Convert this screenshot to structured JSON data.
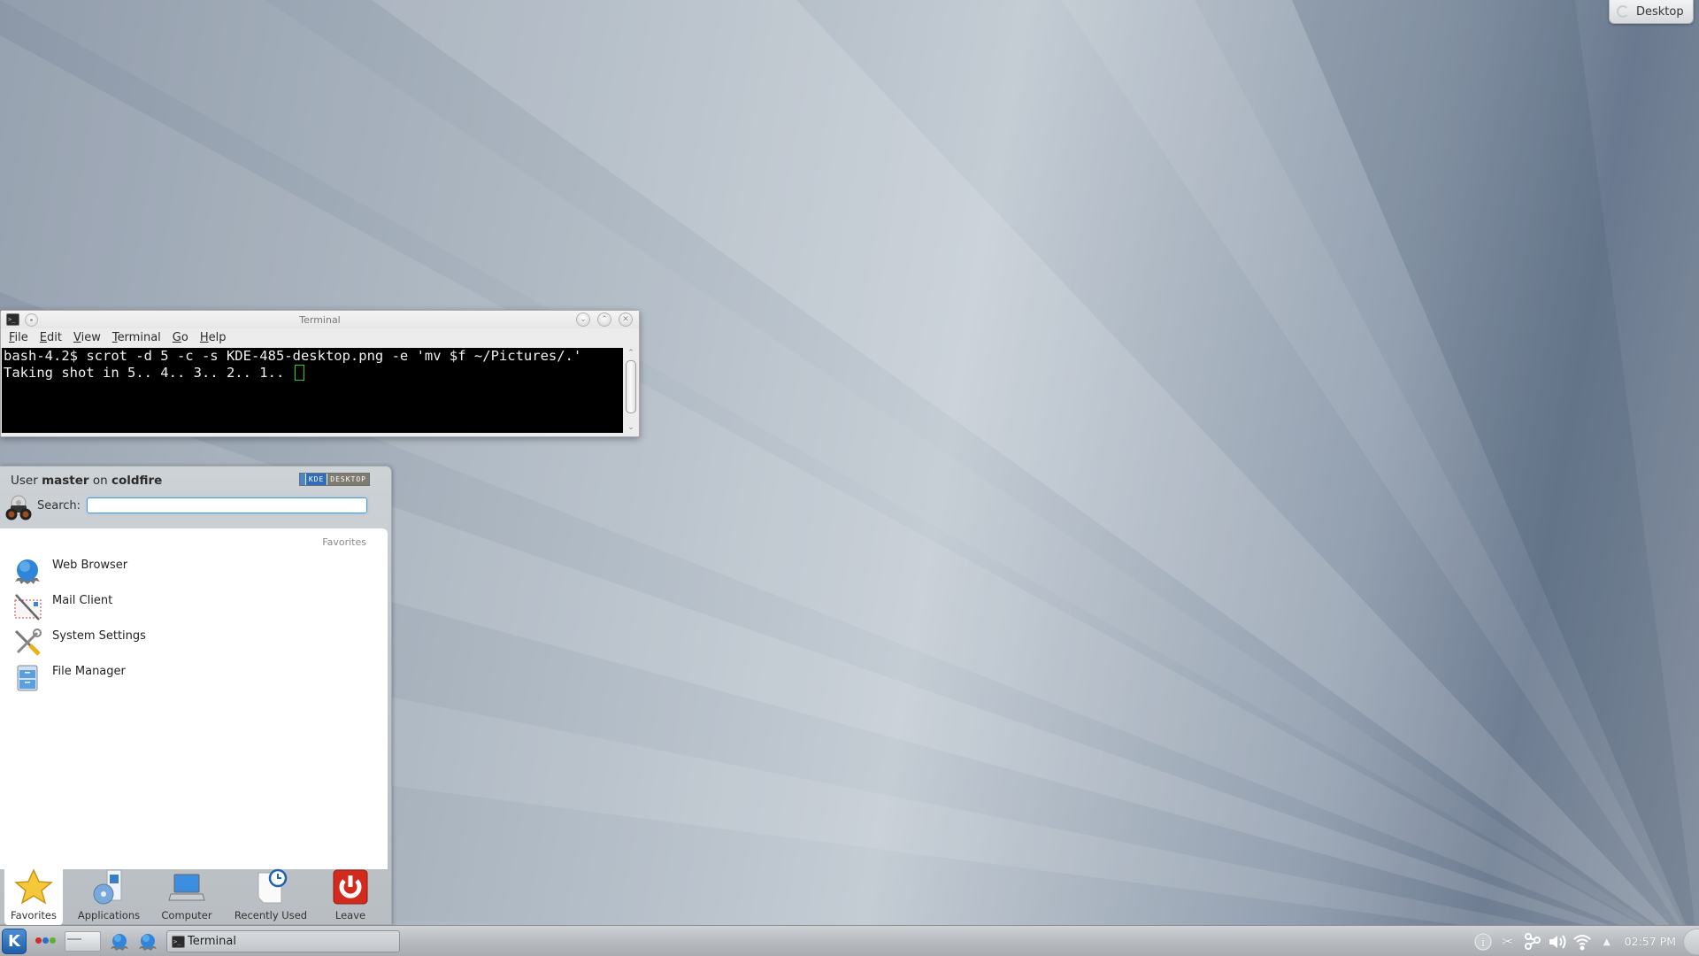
{
  "desktop": {
    "toolbox_label": "Desktop"
  },
  "terminal": {
    "title": "Terminal",
    "menu": [
      {
        "label": "File",
        "mnemonic": "F",
        "rest": "ile"
      },
      {
        "label": "Edit",
        "mnemonic": "E",
        "rest": "dit"
      },
      {
        "label": "View",
        "mnemonic": "V",
        "rest": "iew"
      },
      {
        "label": "Terminal",
        "mnemonic": "T",
        "rest": "erminal"
      },
      {
        "label": "Go",
        "mnemonic": "G",
        "rest": "o"
      },
      {
        "label": "Help",
        "mnemonic": "H",
        "rest": "elp"
      }
    ],
    "lines": [
      "bash-4.2$ scrot -d 5 -c -s KDE-485-desktop.png -e 'mv $f ~/Pictures/.'",
      "Taking shot in 5.. 4.. 3.. 2.. 1.. "
    ],
    "cursor_color": "#22d422",
    "window_buttons": [
      "minimize",
      "maximize",
      "close"
    ]
  },
  "launcher": {
    "user_prefix": "User ",
    "user_name": "master",
    "user_mid": " on ",
    "host_name": "coldfire",
    "badge": {
      "kde": "KDE",
      "desktop": "DESKTOP"
    },
    "search_label": "Search:",
    "search_value": "",
    "section_header": "Favorites",
    "favorites": [
      {
        "label": "Web Browser",
        "icon": "web-browser-icon"
      },
      {
        "label": "Mail Client",
        "icon": "mail-client-icon"
      },
      {
        "label": "System Settings",
        "icon": "system-settings-icon"
      },
      {
        "label": "File Manager",
        "icon": "file-manager-icon"
      }
    ],
    "tabs": [
      {
        "label": "Favorites",
        "icon": "star-icon",
        "active": true
      },
      {
        "label": "Applications",
        "icon": "applications-icon",
        "active": false
      },
      {
        "label": "Computer",
        "icon": "computer-icon",
        "active": false
      },
      {
        "label": "Recently Used",
        "icon": "recently-used-icon",
        "active": false
      },
      {
        "label": "Leave",
        "icon": "leave-icon",
        "active": false
      }
    ]
  },
  "taskbar": {
    "tasks": [
      {
        "label": "Terminal",
        "icon": "terminal-icon"
      }
    ],
    "activity_colors": [
      "#d22b2b",
      "#2c6bd0",
      "#5eb02d"
    ],
    "tray": [
      "info-icon",
      "klipper-scissors-icon",
      "network-share-icon",
      "volume-icon",
      "wifi-icon",
      "expand-arrow-icon"
    ],
    "clock": "02:57 PM"
  }
}
